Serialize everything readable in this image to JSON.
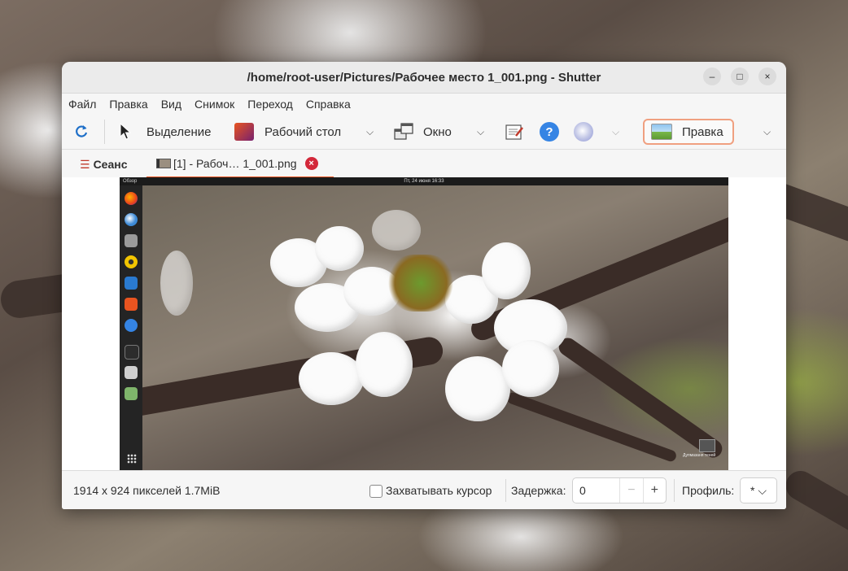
{
  "window": {
    "title": "/home/root-user/Pictures/Рабочее место 1_001.png - Shutter"
  },
  "window_controls": {
    "minimize": "–",
    "maximize": "□",
    "close": "×"
  },
  "menu": [
    "Файл",
    "Правка",
    "Вид",
    "Снимок",
    "Переход",
    "Справка"
  ],
  "toolbar": {
    "refresh_icon": "refresh-icon",
    "selection_label": "Выделение",
    "desktop_label": "Рабочий стол",
    "window_label": "Окно",
    "edit_label": "Правка",
    "chevron": "⌵"
  },
  "tabs": {
    "session_label": "Сеанс",
    "file_tab_label": "[1] - Рабоч… 1_001.png",
    "close_glyph": "×"
  },
  "preview": {
    "activities": "Обзор",
    "clock": "Пт, 24 июня 16:33",
    "trash_label": "Дупмазаня теней"
  },
  "status": {
    "info": "1914 x 924 пикселей  1.7MiB",
    "capture_cursor_label": "Захватывать курсор",
    "capture_cursor_checked": false,
    "delay_label": "Задержка:",
    "delay_value": "0",
    "minus": "−",
    "plus": "+",
    "profile_label": "Профиль:",
    "profile_value": "* ⌵"
  },
  "colors": {
    "accent": "#e95420",
    "close_badge": "#d3283a",
    "help_blue": "#3584e4"
  }
}
